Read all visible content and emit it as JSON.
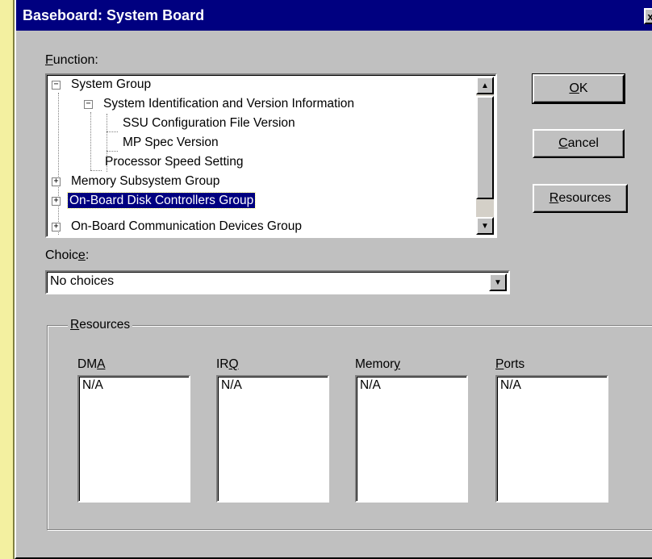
{
  "window": {
    "title": "Baseboard: System Board",
    "close_glyph": "x"
  },
  "function": {
    "label_first": "F",
    "label_rest": "unction:",
    "tree": [
      {
        "label": "System Group",
        "expander": "−"
      },
      {
        "label": "System Identification and Version Information",
        "expander": "−"
      },
      {
        "label": "SSU Configuration File Version"
      },
      {
        "label": "MP Spec Version"
      },
      {
        "label": "Processor Speed Setting"
      },
      {
        "label": "Memory Subsystem Group",
        "expander": "+"
      },
      {
        "label": "On-Board Disk Controllers Group",
        "expander": "+",
        "selected": true
      },
      {
        "label": "On-Board Communication Devices Group",
        "expander": "+"
      }
    ]
  },
  "choice": {
    "label_pre": "Choic",
    "label_u": "e",
    "label_post": ":",
    "value": "No choices"
  },
  "buttons": {
    "ok": {
      "u": "O",
      "rest": "K"
    },
    "cancel": {
      "u": "C",
      "rest": "ancel"
    },
    "resources": {
      "u": "R",
      "rest": "esources"
    }
  },
  "resources": {
    "group_u": "R",
    "group_rest": "esources",
    "columns": [
      {
        "pre": "DM",
        "u": "A",
        "post": "",
        "value": "N/A"
      },
      {
        "pre": "IR",
        "u": "Q",
        "post": "",
        "value": "N/A"
      },
      {
        "pre": "Memor",
        "u": "y",
        "post": "",
        "value": "N/A"
      },
      {
        "pre": "",
        "u": "P",
        "post": "orts",
        "value": "N/A"
      }
    ]
  },
  "icons": {
    "scroll_up": "▲",
    "scroll_down": "▼",
    "dropdown": "▼"
  }
}
